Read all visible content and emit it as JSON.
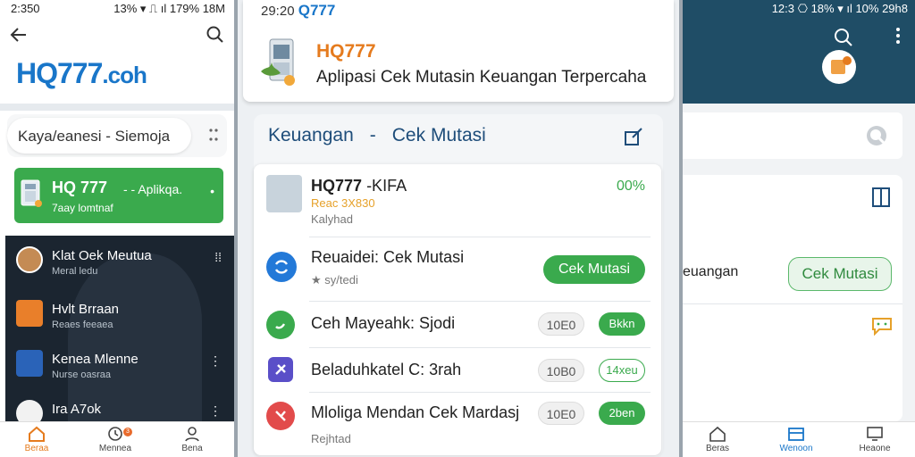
{
  "left": {
    "status_time": "2:350",
    "status_right": "13% ▾ ⎍ ıl 179% 18M",
    "logo": "HQ777",
    "logo_domain": ".coh",
    "search_text": "Kaya/eanesi - Siemoja",
    "green_card": {
      "title": "HQ 777",
      "tag": "- - Aplikqa.",
      "sub": "7aay lomtnaf"
    },
    "dark_rows": [
      {
        "name": "Klat Oek Meutua",
        "sub": "Meral ledu"
      },
      {
        "name": "Hvlt Brraan",
        "sub": "Reaes feeaea"
      },
      {
        "name": "Kenea Mlenne",
        "sub": "Nurse oasraa"
      },
      {
        "name": "Ira A7ok",
        "sub": ""
      }
    ],
    "nav": [
      {
        "label": "Beraa"
      },
      {
        "label": "Mennea"
      },
      {
        "label": "Bena"
      }
    ],
    "badge": "3"
  },
  "middle": {
    "status_time": "29:20",
    "status_brand": "Q777",
    "app_name": "HQ777",
    "app_desc": "Aplipasi Cek Mutasin Keuangan Terpercaha",
    "card_left": "Keuangan",
    "card_dash": "-",
    "card_right": "Cek Mutasi",
    "rows": [
      {
        "name": "HQ777",
        "extra": "-KIFA",
        "sub1": "Reac 3X830",
        "sub2": "Kalyhad",
        "pct": "00%"
      },
      {
        "name": "Reuaidei: Cek Mutasi",
        "sub": "★ sy/tedi",
        "button": "Cek Mutasi"
      },
      {
        "name": "Ceh Mayeahk: Sjodi",
        "pill": "10E0",
        "btn": "Bkkn"
      },
      {
        "name": "Beladuhkatel C: 3rah",
        "pill": "10B0",
        "btn": "14xeu"
      },
      {
        "name": "Mloliga Mendan Cek Mardasj",
        "pill": "10E0",
        "btn": "2ben",
        "sub": "Rejhtad"
      }
    ]
  },
  "right": {
    "status": "12:3 ⎔ 18% ▾ ıl 10% 29h8",
    "label": "euangan",
    "button": "Cek Mutasi",
    "nav": [
      {
        "label": "Beras"
      },
      {
        "label": "Wenoon"
      },
      {
        "label": "Heaone"
      }
    ]
  },
  "colors": {
    "brand_blue": "#1976c9",
    "green": "#3aaa4d",
    "orange": "#e57b1e",
    "teal_header": "#1f4d66"
  }
}
